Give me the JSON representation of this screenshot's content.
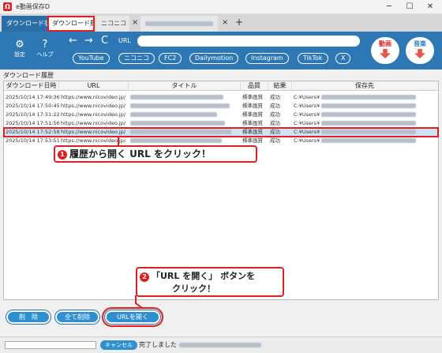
{
  "window": {
    "app_icon_glyph": "Ω",
    "title": "e動画保存D",
    "minimize": "─",
    "maximize": "☐",
    "close": "✕"
  },
  "tabs": [
    {
      "label": "ダウンロード状況"
    },
    {
      "label": "ダウンロード履歴"
    },
    {
      "label": "ニコニコ",
      "close": "×"
    },
    {
      "label": "",
      "close": "×"
    }
  ],
  "tab_add": "+",
  "toolbar": {
    "settings_label": "設定",
    "settings_icon": "gear-icon",
    "help_label": "ヘルプ",
    "help_icon": "question-icon",
    "back": "←",
    "forward": "→",
    "reload": "C",
    "url_label": "URL",
    "url_value": "",
    "sites": [
      "YouTube",
      "ニコニコ",
      "FC2",
      "Dailymotion",
      "Instagram",
      "TikTok",
      "X"
    ],
    "video_button": "動画",
    "music_button": "音楽"
  },
  "section_title": "ダウンロード履歴",
  "table": {
    "columns": [
      "ダウンロード日時",
      "URL",
      "タイトル",
      "品質",
      "結果",
      "保存先"
    ],
    "rows": [
      [
        "2025/10/14 17:49:36",
        "https://www.nicovideo.jp/",
        "",
        "標準画質",
        "成功",
        "C:¥Users¥"
      ],
      [
        "2025/10/14 17:50:45",
        "https://www.nicovideo.jp/",
        "",
        "標準画質",
        "成功",
        "C:¥Users¥"
      ],
      [
        "2025/10/14 17:51:22",
        "https://www.nicovideo.jp/",
        "",
        "標準画質",
        "成功",
        "C:¥Users¥"
      ],
      [
        "2025/10/14 17:51:56",
        "https://www.nicovideo.jp/",
        "",
        "標準画質",
        "成功",
        "C:¥Users¥"
      ],
      [
        "2025/10/14 17:52:58",
        "https://www.nicovideo.jp/",
        "",
        "標準画質",
        "成功",
        "C:¥Users¥"
      ],
      [
        "2025/10/14 17:53:51",
        "https://www.nicovideo.jp/",
        "",
        "標準画質",
        "成功",
        "C:¥Users¥"
      ]
    ],
    "selected_row": 4
  },
  "callouts": {
    "step1_num": "1",
    "step1_text": "履歴から開く URL をクリック！",
    "step2_num": "2",
    "step2_line1": "「URL を開く」 ボタンを",
    "step2_line2": "クリック！"
  },
  "buttons": {
    "delete": "削　除",
    "delete_all": "全て削除",
    "open_url": "URLを開く"
  },
  "status": {
    "cancel": "キャンセル",
    "text": "完了しました",
    "progress": 0
  },
  "colors": {
    "accent": "#2d77b5",
    "highlight": "#e02020",
    "button": "#2f8fd0"
  }
}
